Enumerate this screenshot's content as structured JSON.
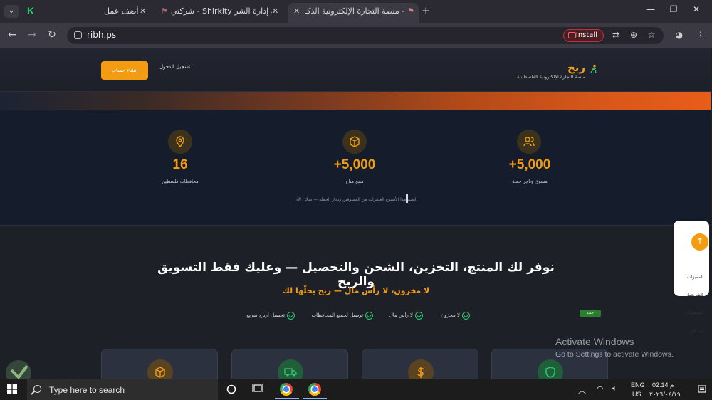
{
  "browser": {
    "tabs": [
      {
        "title": "أضف عمل",
        "favicon": "k-logo-icon"
      },
      {
        "title": "شركتي - Shirkity منصة إدارة الشر",
        "favicon": "flag-icon"
      },
      {
        "title": "ربح - منصة التجارة الإلكترونية الذكـ",
        "favicon": "flag-icon",
        "active": true
      }
    ],
    "url": "ribh.ps",
    "install_label": "Install"
  },
  "site": {
    "brand": "ربح",
    "tagline": "منصة التجارة الإلكترونية الفلسطينية",
    "signup_label": "إنشاء حساب",
    "login_label": "تسجيل الدخول"
  },
  "stats": {
    "items": [
      {
        "value": "+5,000",
        "label": "مسوق وتاجر جملة",
        "icon": "users-icon"
      },
      {
        "value": "+5,000",
        "label": "منتج متاح",
        "icon": "box-icon"
      },
      {
        "value": "16",
        "label": "محافظات فلسطين",
        "icon": "location-pin-icon"
      }
    ],
    "note": "انضم هذا الأسبوع العشرات من المسوقين وتجار الجملة — سجّل الآن."
  },
  "hero": {
    "title": "نوفر لك المنتج، التخزين، الشحن والتحصيل — وعليك فقط التسويق والربح",
    "subtitle": "لا مخزون، لا رأس مال — ربح يحلّها لك",
    "features": [
      "لا مخزون",
      "لا رأس مال",
      "توصيل لجميع المحافظات",
      "تحصيل أرباح سريع"
    ],
    "cards": [
      {
        "icon": "shield-icon",
        "color": "#1f5f3a"
      },
      {
        "icon": "dollar-icon",
        "color": "#5a4320"
      },
      {
        "icon": "truck-icon",
        "color": "#1f5f3a"
      },
      {
        "icon": "box-icon",
        "color": "#5a4320"
      }
    ],
    "badge": "جديد"
  },
  "sidenav": {
    "items": [
      "المميزات",
      "كيف يعمل",
      "التسعيرات",
      "ابدأ الآن"
    ]
  },
  "watermark": {
    "line1": "Activate Windows",
    "line2": "Go to Settings to activate Windows."
  },
  "taskbar": {
    "search_placeholder": "Type here to search",
    "lang_line1": "ENG",
    "lang_line2": "US",
    "time": "02:14 م",
    "date": "٢٠٢٦/٠٤/١٩"
  },
  "colors": {
    "accent": "#f39c12",
    "check": "#2ecc71",
    "stats_bg": "#151d2d"
  }
}
